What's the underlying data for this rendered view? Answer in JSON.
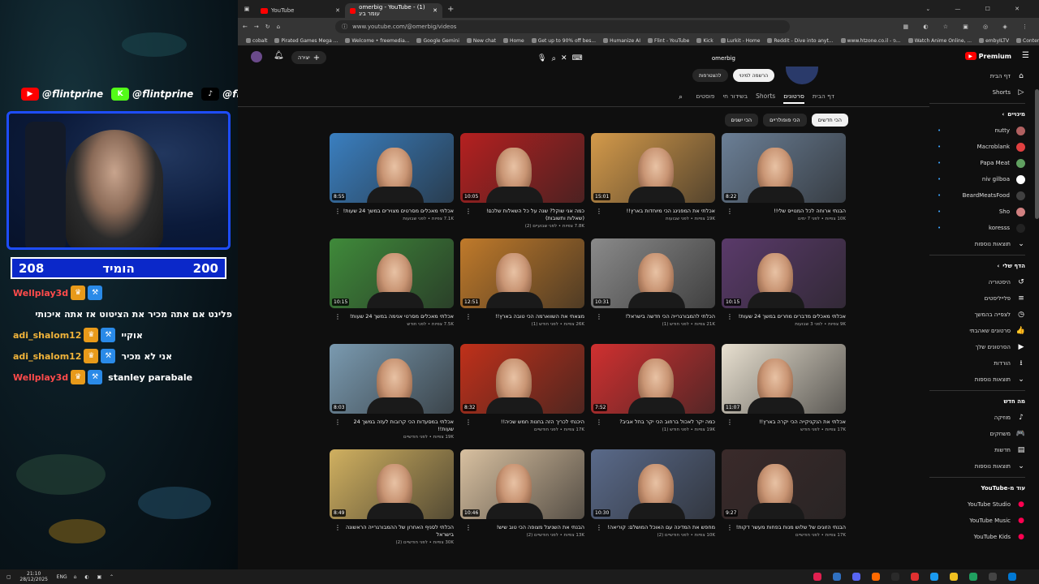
{
  "stream": {
    "socials": [
      {
        "icon": "youtube-icon",
        "handle": "@flintprine",
        "color": "#ff0000",
        "glyph": "▶"
      },
      {
        "icon": "kick-icon",
        "handle": "@flintprine",
        "color": "#53fc18",
        "glyph": "K"
      },
      {
        "icon": "tiktok-icon",
        "handle": "@flintprine",
        "color": "#000000",
        "glyph": "♪"
      }
    ],
    "bar": {
      "left_value": "208",
      "label": "הומיד",
      "right_value": "200"
    },
    "chat": [
      {
        "user": "Wellplay3d",
        "message": "",
        "red": true
      },
      {
        "user": "",
        "message": "פלינט אם אתה מכיר את הציטוט אז אתה איכותי",
        "red": false
      },
      {
        "user": "adi_shalom12",
        "message": "אוקיי",
        "red": false
      },
      {
        "user": "adi_shalom12",
        "message": "אני לא מכיר",
        "red": false
      },
      {
        "user": "Wellplay3d",
        "message": "stanley parabale",
        "red": true
      }
    ]
  },
  "browser": {
    "tabs": [
      {
        "label": "YouTube",
        "active": false
      },
      {
        "label": "omerbig - YouTube - (1) עומר ביג",
        "active": true
      }
    ],
    "url": "www.youtube.com/@omerbig/videos",
    "bookmarks": [
      "cobalt",
      "Pirated Games Mega ...",
      "Welcome • freemedia...",
      "Google Gemini",
      "New chat",
      "Home",
      "Get up to 90% off bes...",
      "Humanize AI",
      "Flint - YouTube",
      "Kick",
      "Lurkit - Home",
      "Reddit - Dive into anyt...",
      "www.htzone.co.il - פ...",
      "Watch Anime Online, ...",
      "embyILTV",
      "Content"
    ]
  },
  "youtube": {
    "logo": "Premium",
    "search_query": "omerbig",
    "create_label": "יצירה",
    "notification_count": "",
    "header_buttons": {
      "join": "להצטרפות",
      "subscribed": "הרשמה למינוי"
    },
    "channel_tabs": [
      "דף הבית",
      "סרטונים",
      "Shorts",
      "בשידור חי",
      "פוסטים"
    ],
    "active_tab": "סרטונים",
    "filters": [
      "הכי חדשים",
      "הכי פופולריים",
      "הכי ישנים"
    ],
    "active_filter": "הכי חדשים",
    "videos": [
      {
        "title": "הבנתי ארוחה לכל המנוייס שלי!!",
        "meta": "10K צפיות • לפני 7 ימים",
        "duration": "8:22",
        "bg": "#6b7f96"
      },
      {
        "title": "אכלתי את המפנינג הכי מיוחדות בארץ!!",
        "meta": "19K צפיות • לפני שבועות",
        "duration": "15:01",
        "bg": "#d49a4a"
      },
      {
        "title": "כמה אני שוקל? שנה על כל השאלות שלכם! (שאלות ותשובות)",
        "meta": "7.8K צפיות • לפני שבועיים (2)",
        "duration": "10:05",
        "bg": "#b52020"
      },
      {
        "title": "אכלתי מאכלים מסרטים מצוירים במשך 24 שעות!",
        "meta": "7.1K צפיות • לפני שבועות",
        "duration": "8:55",
        "bg": "#3a7fc0"
      },
      {
        "title": "אכלתי מאכלים מדברים מחרים במשך 24 שעות!",
        "meta": "9K צפיות • לפני 3 שבועות",
        "duration": "10:15",
        "bg": "#5a3a6a"
      },
      {
        "title": "הכלתי להמבורגרייה הכי חדשה בישראל!",
        "meta": "21K צפיות • לפני חודש (1)",
        "duration": "10:31",
        "bg": "#8a8a8a"
      },
      {
        "title": "מצאתי את השווארמה הכי טובה בארץ!!",
        "meta": "26K צפיות • לפני חודש (1)",
        "duration": "12:51",
        "bg": "#c07a2a"
      },
      {
        "title": "אכלתי מאכלים מסרטי אנימה במשך 24 שעות!",
        "meta": "7.5K צפיות • לפני חודש",
        "duration": "10:15",
        "bg": "#3f8a3a"
      },
      {
        "title": "אכלתי את הנקניקייה הכי יקרה בארץ!!",
        "meta": "17K צפיות • לפני חודש",
        "duration": "11:07",
        "bg": "#e8e0d0"
      },
      {
        "title": "כמה יקר לאכול ברחוב הכי יקר בתל אביב?",
        "meta": "19K צפיות • לפני חודש (1)",
        "duration": "7:52",
        "bg": "#d03030"
      },
      {
        "title": "היכנתי לכריך הזה בחנות חמש שכיה!!",
        "meta": "17K צפיות • לפני חודשיים",
        "duration": "8:32",
        "bg": "#c0301a"
      },
      {
        "title": "אכלתי במסעדות הכי קרובות לעזה במשך 24 שעות!!",
        "meta": "19K צפיות • לפני חודשיים",
        "duration": "8:03",
        "bg": "#7a9ab0"
      },
      {
        "title": "הבנתי הזוגים של שלוש מנות בפחות מעשר דקות!",
        "meta": "17K צפיות • לפני חודשיים",
        "duration": "9:27",
        "bg": "#3a2a2a"
      },
      {
        "title": "מחפש את המדינה עם האוכל המושלם: קוריאה!",
        "meta": "10K צפיות • לפני חודשיים (2)",
        "duration": "10:30",
        "bg": "#5a6a8a"
      },
      {
        "title": "הבנתי את השניצל מצופה הכי טוב שיש!",
        "meta": "13K צפיות • לפני חודשיים (2)",
        "duration": "10:46",
        "bg": "#d8c0a0"
      },
      {
        "title": "הכלתי לסניף האחרון של ההמבורגרייה הראשונה בישראל",
        "meta": "30K צפיות • לפני חודשיים (2)",
        "duration": "8:49",
        "bg": "#d0b060"
      }
    ],
    "sidebar": {
      "main": [
        {
          "icon": "home-icon",
          "label": "דף הבית",
          "glyph": "⌂"
        },
        {
          "icon": "shorts-icon",
          "label": "Shorts",
          "glyph": "▷"
        }
      ],
      "subs_title": "מינויים",
      "subs": [
        {
          "label": "nutty",
          "color": "#b06060"
        },
        {
          "label": "Macroblank",
          "color": "#e04040"
        },
        {
          "label": "Papa Meat",
          "color": "#60a060"
        },
        {
          "label": "niv gilboa",
          "color": "#ffffff"
        },
        {
          "label": "BeardMeatsFood",
          "color": "#404040"
        },
        {
          "label": "Sho",
          "color": "#d08080"
        },
        {
          "label": "koresss",
          "color": "#222222"
        }
      ],
      "show_more": "תוצאות נוספות",
      "you_title": "הדף שלי",
      "you": [
        {
          "icon": "history-icon",
          "label": "היסטוריה",
          "glyph": "↺"
        },
        {
          "icon": "playlists-icon",
          "label": "פלייליסטים",
          "glyph": "≡"
        },
        {
          "icon": "watch-later-icon",
          "label": "לצפייה בהמשך",
          "glyph": "◷"
        },
        {
          "icon": "liked-icon",
          "label": "סרטונים שאהבתי",
          "glyph": "👍"
        },
        {
          "icon": "your-videos-icon",
          "label": "הסרטונים שלך",
          "glyph": "▶"
        },
        {
          "icon": "downloads-icon",
          "label": "הורדות",
          "glyph": "⭳"
        }
      ],
      "explore_title": "מה חדש",
      "explore": [
        {
          "icon": "music-icon",
          "label": "מוזיקה",
          "glyph": "♪"
        },
        {
          "icon": "gaming-icon",
          "label": "משחקים",
          "glyph": "🎮"
        },
        {
          "icon": "news-icon",
          "label": "חדשות",
          "glyph": "▤"
        }
      ],
      "more_title": "עוד מ-YouTube",
      "more": [
        {
          "label": "YouTube Studio"
        },
        {
          "label": "YouTube Music"
        },
        {
          "label": "YouTube Kids"
        }
      ]
    }
  },
  "taskbar": {
    "time": "21:10",
    "date": "28/12/2025",
    "lang": "ENG"
  },
  "colors": {
    "accent": "#ff0000",
    "bg": "#0f0f0f",
    "stream_bar": "#0b28c9",
    "cam_border": "#1e4dff"
  }
}
